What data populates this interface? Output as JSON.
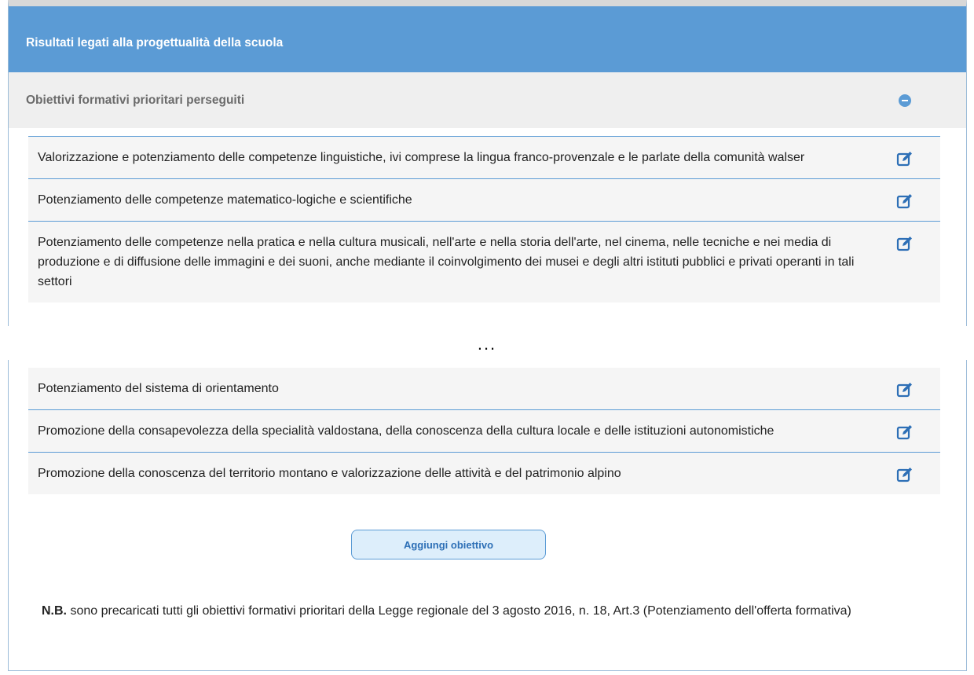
{
  "header": {
    "title": "Risultati legati alla progettualità della scuola"
  },
  "section": {
    "title": "Obiettivi formativi prioritari perseguiti"
  },
  "objectives_top": [
    {
      "label": "Valorizzazione e potenziamento delle competenze linguistiche, ivi comprese la lingua franco-provenzale e le parlate della comunità walser"
    },
    {
      "label": "Potenziamento delle competenze matematico-logiche e scientifiche"
    },
    {
      "label": "Potenziamento delle competenze nella pratica e nella cultura musicali, nell'arte e nella storia dell'arte, nel cinema, nelle tecniche e nei media di produzione e di diffusione delle immagini e dei suoni, anche mediante il coinvolgimento dei musei e degli altri istituti pubblici e privati operanti in tali settori"
    }
  ],
  "ellipsis": "...",
  "objectives_bottom": [
    {
      "label": "Potenziamento del sistema di orientamento"
    },
    {
      "label": "Promozione della consapevolezza della specialità valdostana, della conoscenza della cultura locale e delle istituzioni autonomistiche"
    },
    {
      "label": "Promozione della conoscenza del territorio montano e valorizzazione delle attività e del patrimonio alpino"
    }
  ],
  "add_button": {
    "label": "Aggiungi obiettivo"
  },
  "note": {
    "prefix": "N.B.",
    "text": " sono precaricati tutti gli obiettivi formativi prioritari della Legge regionale del 3 agosto 2016, n. 18, Art.3 (Potenziamento dell'offerta formativa)"
  },
  "icons": {
    "collapse": "minus-circle-icon",
    "edit": "edit-icon"
  },
  "colors": {
    "accent": "#5b9bd5",
    "button_bg": "#ddeefb",
    "button_text": "#2d6fb6"
  }
}
